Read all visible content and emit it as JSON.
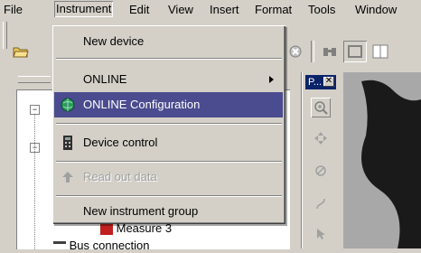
{
  "menubar": {
    "items": [
      {
        "label": "File"
      },
      {
        "label": "Instrument"
      },
      {
        "label": "Edit"
      },
      {
        "label": "View"
      },
      {
        "label": "Insert"
      },
      {
        "label": "Format"
      },
      {
        "label": "Tools"
      },
      {
        "label": "Window"
      }
    ]
  },
  "instrument_menu": {
    "items": [
      {
        "label": "New device",
        "icon": "none"
      },
      {
        "label": "ONLINE",
        "icon": "none",
        "submenu": true
      },
      {
        "label": "ONLINE Configuration",
        "icon": "globe-icon",
        "highlighted": true
      },
      {
        "label": "Device control",
        "icon": "device-control-icon"
      },
      {
        "label": "Read out data",
        "icon": "upload-arrow-icon",
        "disabled": true
      },
      {
        "label": "New instrument group",
        "icon": "none"
      }
    ]
  },
  "tree": {
    "items": [
      {
        "label": "Measure 3"
      },
      {
        "label": "Bus connection"
      }
    ]
  },
  "palette": {
    "title": "P..."
  },
  "colors": {
    "highlight": "#4b4b8f",
    "face": "#d4d0c8",
    "title_bar": "#0a246a"
  }
}
